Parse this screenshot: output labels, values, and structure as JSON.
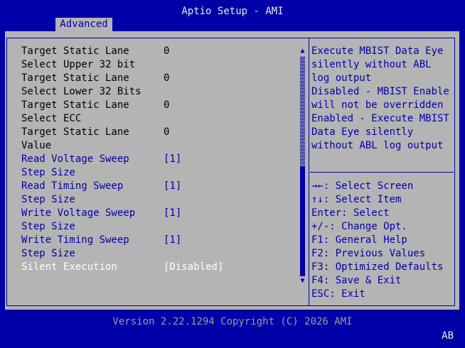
{
  "app": {
    "title": "Aptio Setup - AMI",
    "active_tab": "Advanced"
  },
  "settings": [
    {
      "label": "Target Static Lane",
      "value": "0",
      "style": "black"
    },
    {
      "label": "Select Upper 32 bit",
      "value": "",
      "style": "black"
    },
    {
      "label": "Target Static Lane",
      "value": "0",
      "style": "black"
    },
    {
      "label": "Select Lower 32 Bits",
      "value": "",
      "style": "black"
    },
    {
      "label": "Target Static Lane",
      "value": "0",
      "style": "black"
    },
    {
      "label": "Select ECC",
      "value": "",
      "style": "black"
    },
    {
      "label": "Target Static Lane",
      "value": "0",
      "style": "black"
    },
    {
      "label": "Value",
      "value": "",
      "style": "black"
    },
    {
      "label": "Read Voltage Sweep",
      "value": "[1]",
      "style": "blue"
    },
    {
      "label": "Step Size",
      "value": "",
      "style": "blue"
    },
    {
      "label": "Read Timing Sweep",
      "value": "[1]",
      "style": "blue"
    },
    {
      "label": "Step Size",
      "value": "",
      "style": "blue"
    },
    {
      "label": "Write Voltage Sweep",
      "value": "[1]",
      "style": "blue"
    },
    {
      "label": "Step Size",
      "value": "",
      "style": "blue"
    },
    {
      "label": "Write Timing Sweep",
      "value": "[1]",
      "style": "blue"
    },
    {
      "label": "Step Size",
      "value": "",
      "style": "blue"
    },
    {
      "label": "Silent Execution",
      "value": "[Disabled]",
      "style": "white"
    }
  ],
  "help_text": [
    "Execute MBIST Data Eye",
    "silently without ABL",
    "log output",
    "Disabled - MBIST Enable",
    "will not be overridden",
    "Enabled - Execute MBIST",
    "Data Eye silently",
    "without ABL log output"
  ],
  "key_help": [
    "→←: Select Screen",
    "↑↓: Select Item",
    "Enter: Select",
    "+/-: Change Opt.",
    "F1: General Help",
    "F2: Previous Values",
    "F3: Optimized Defaults",
    "F4: Save & Exit",
    "ESC: Exit"
  ],
  "scrollbar": {
    "up_arrow": "▲",
    "down_arrow": "▼",
    "position": 1.0
  },
  "footer": {
    "version": "Version 2.22.1294 Copyright (C) 2026 AMI",
    "corner": "AB"
  },
  "colors": {
    "background": "#0000a8",
    "panel": "#b4b4b4",
    "selected_text": "#ffffff",
    "static_text": "#000000",
    "option_text": "#0000a8"
  }
}
